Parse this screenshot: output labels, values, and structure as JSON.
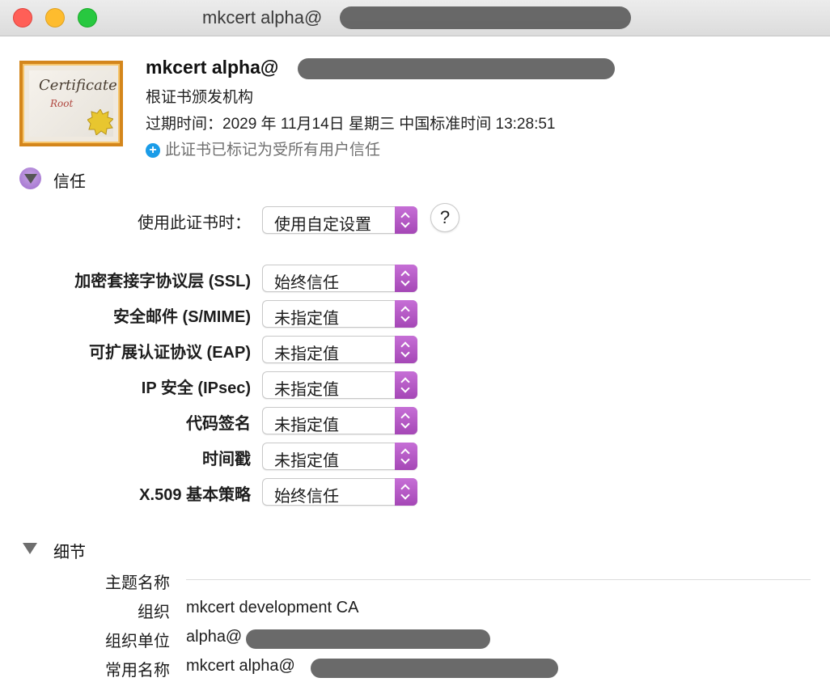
{
  "window": {
    "title": "mkcert alpha@"
  },
  "header": {
    "cert_name": "mkcert alpha@",
    "cert_type": "根证书颁发机构",
    "expiry": "过期时间：2029 年 11月14日 星期三 中国标准时间 13:28:51",
    "trusted_text": "此证书已标记为受所有用户信任",
    "icon_word": "Certificate",
    "icon_root": "Root"
  },
  "trust": {
    "section_title": "信任",
    "when_using_label": "使用此证书时：",
    "when_using_value": "使用自定设置",
    "help_label": "?",
    "rows": [
      {
        "label": "加密套接字协议层 (SSL)",
        "value": "始终信任"
      },
      {
        "label": "安全邮件 (S/MIME)",
        "value": "未指定值"
      },
      {
        "label": "可扩展认证协议 (EAP)",
        "value": "未指定值"
      },
      {
        "label": "IP 安全 (IPsec)",
        "value": "未指定值"
      },
      {
        "label": "代码签名",
        "value": "未指定值"
      },
      {
        "label": "时间戳",
        "value": "未指定值"
      },
      {
        "label": "X.509 基本策略",
        "value": "始终信任"
      }
    ]
  },
  "details": {
    "section_title": "细节",
    "subject_name_label": "主题名称",
    "rows": [
      {
        "label": "组织",
        "value": "mkcert development CA"
      },
      {
        "label": "组织单位",
        "value": "alpha@"
      },
      {
        "label": "常用名称",
        "value": "mkcert alpha@"
      }
    ]
  }
}
